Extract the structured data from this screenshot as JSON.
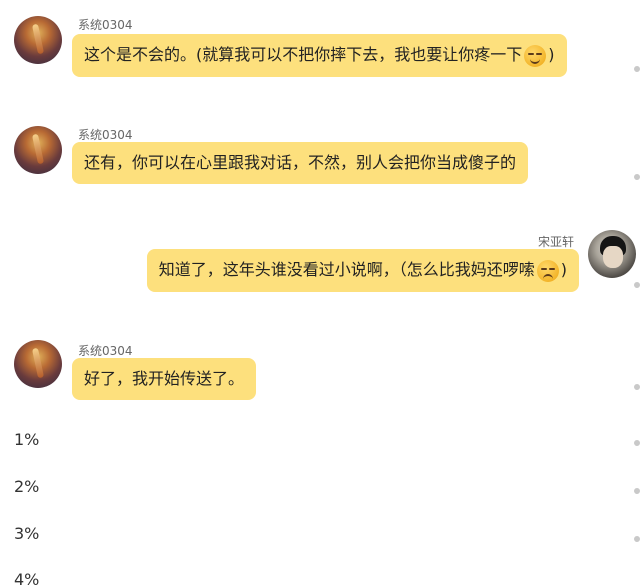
{
  "messages": [
    {
      "sender": "系统0304",
      "text_before": "这个是不会的。(就算我可以不把你摔下去，我也要让你疼一下",
      "emoji": "smirk-emoji",
      "text_after": ")"
    },
    {
      "sender": "系统0304",
      "text": "还有，你可以在心里跟我对话，不然，别人会把你当成傻子的"
    },
    {
      "sender": "宋亚轩",
      "text_before": "知道了，这年头谁没看过小说啊，（怎么比我妈还啰嗦",
      "emoji": "unamused-emoji",
      "text_after": ")"
    },
    {
      "sender": "系统0304",
      "text": "好了，我开始传送了。"
    }
  ],
  "progress": [
    "1%",
    "2%",
    "3%",
    "4%"
  ],
  "colors": {
    "bubble": "#fde07d",
    "sender_text": "#666666"
  }
}
